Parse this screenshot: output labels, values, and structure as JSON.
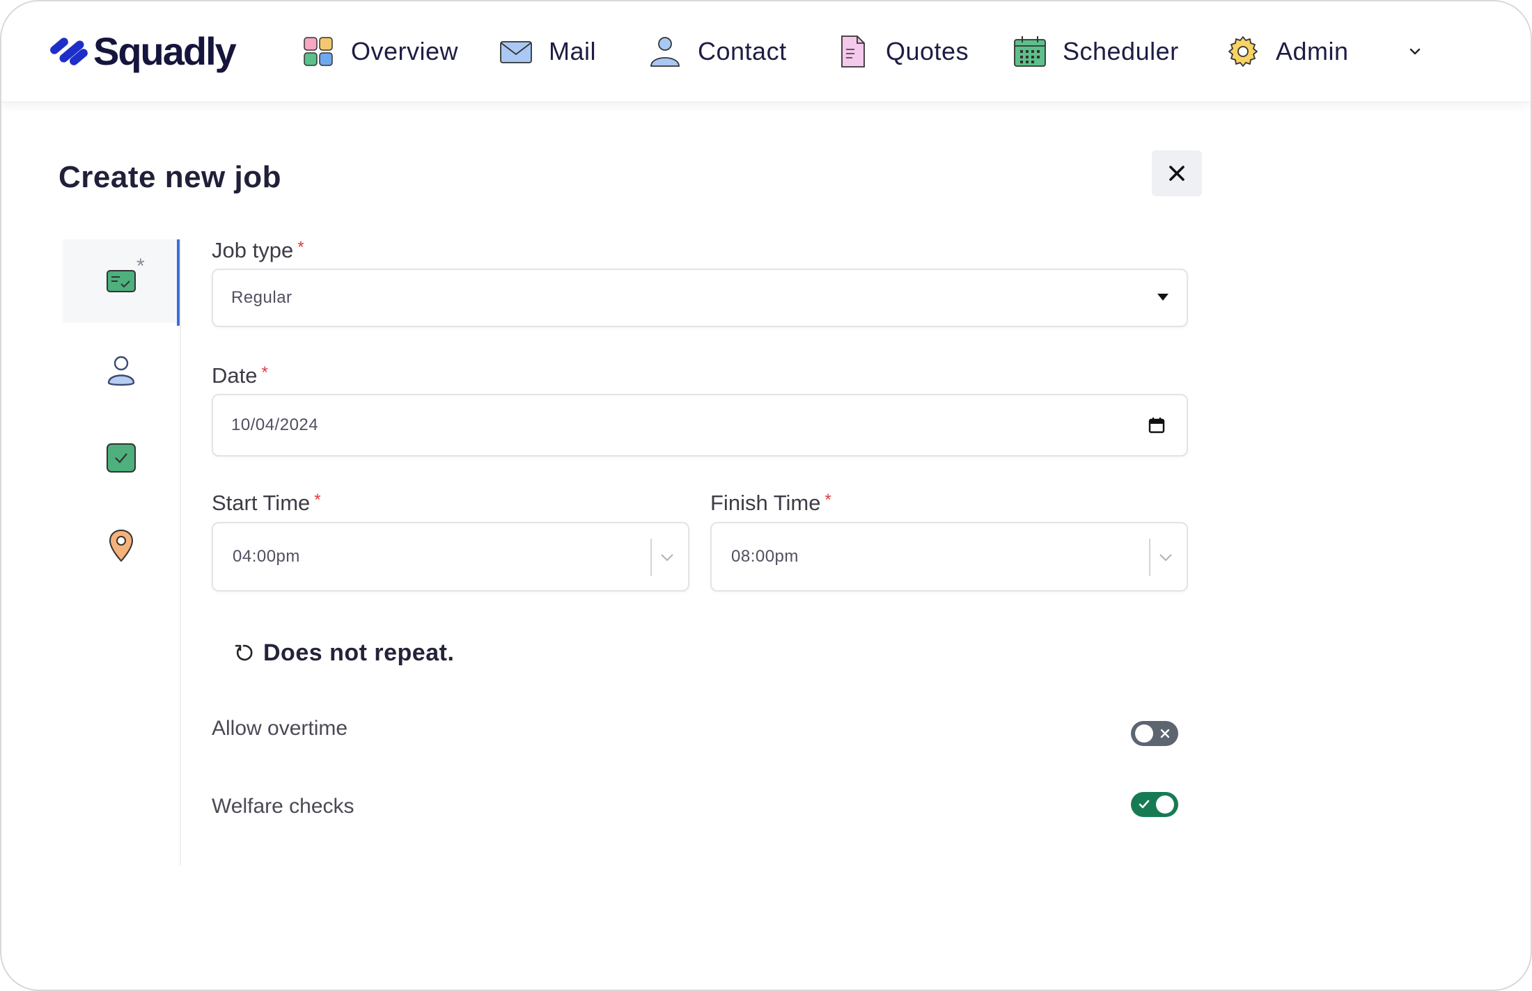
{
  "app": {
    "brand": "Squadly",
    "colors": {
      "brand": "#1d2fc8",
      "accent": "#3b6fd6",
      "toggle_on": "#167b53",
      "toggle_off": "#5d6571",
      "required": "#e23b3b"
    }
  },
  "nav": {
    "items": [
      {
        "label": "Overview",
        "icon": "grid-icon"
      },
      {
        "label": "Mail",
        "icon": "mail-icon"
      },
      {
        "label": "Contact",
        "icon": "user-icon"
      },
      {
        "label": "Quotes",
        "icon": "document-icon"
      },
      {
        "label": "Scheduler",
        "icon": "calendar-icon"
      },
      {
        "label": "Admin",
        "icon": "gear-icon"
      }
    ]
  },
  "page": {
    "title": "Create new job",
    "steps": [
      {
        "icon": "job-card-icon",
        "active": true,
        "marker": "*"
      },
      {
        "icon": "person-icon",
        "active": false
      },
      {
        "icon": "checkbox-icon",
        "active": false
      },
      {
        "icon": "location-pin-icon",
        "active": false
      }
    ]
  },
  "form": {
    "required_mark": "*",
    "job_type": {
      "label": "Job type",
      "value": "Regular"
    },
    "date": {
      "label": "Date",
      "value": "10/04/2024"
    },
    "start_time": {
      "label": "Start Time",
      "value": "04:00pm"
    },
    "finish_time": {
      "label": "Finish Time",
      "value": "08:00pm"
    },
    "repeat": {
      "text": "Does not repeat."
    },
    "allow_overtime": {
      "label": "Allow overtime",
      "enabled": false
    },
    "welfare_checks": {
      "label": "Welfare checks",
      "enabled": true
    }
  }
}
